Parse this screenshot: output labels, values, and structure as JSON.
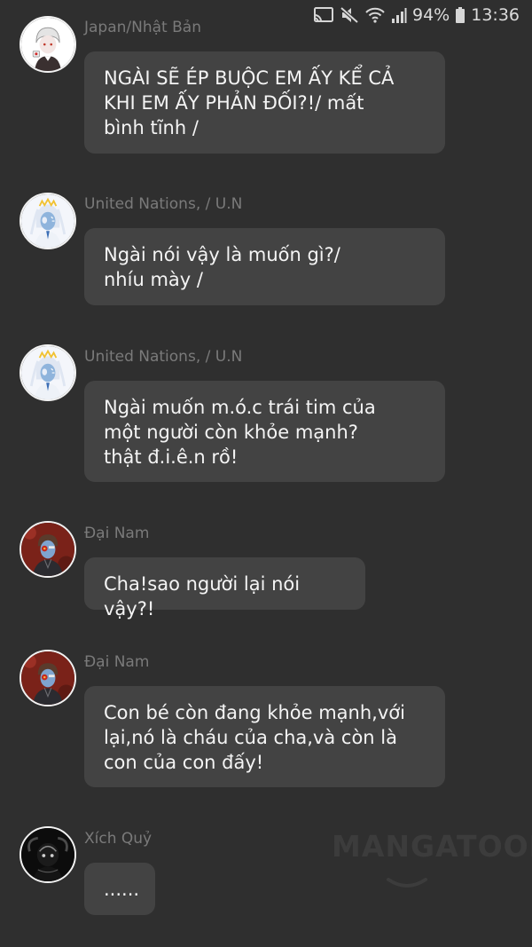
{
  "status_bar": {
    "battery_percent": "94%",
    "time": "13:36",
    "icons": [
      "cast-icon",
      "mute-icon",
      "wifi-icon",
      "signal-icon",
      "battery-icon"
    ]
  },
  "messages": [
    {
      "sender": "Japan/Nhật Bản",
      "avatar": "japan-avatar",
      "text": "NGÀI SẼ ÉP BUỘC EM ẤY KỂ CẢ\nKHI EM ẤY PHẢN ĐỐI?!/ mất\nbình tĩnh /"
    },
    {
      "sender": "United Nations, / U.N",
      "avatar": "united-nations-avatar",
      "text": "Ngài nói vậy là muốn gì?/\nnhíu mày /"
    },
    {
      "sender": "United Nations, / U.N",
      "avatar": "united-nations-avatar",
      "text": "Ngài muốn m.ó.c trái tim của\nmột người còn khỏe mạnh?\nthật đ.i.ê.n rồ!"
    },
    {
      "sender": "Đại Nam",
      "avatar": "dai-nam-avatar",
      "text": "Cha!sao người lại nói vậy?!"
    },
    {
      "sender": "Đại Nam",
      "avatar": "dai-nam-avatar",
      "text": "Con bé còn đang khỏe mạnh,với\nlại,nó là cháu của cha,và còn là\ncon của con đấy!"
    },
    {
      "sender": "Xích Quỷ",
      "avatar": "xich-quy-avatar",
      "text": "......"
    }
  ],
  "watermark": "MANGATOON"
}
